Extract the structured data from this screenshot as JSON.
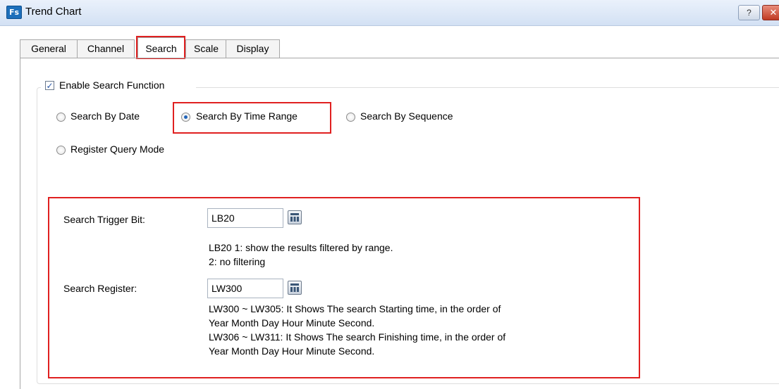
{
  "window": {
    "app_icon_text": "Fs",
    "title": "Trend Chart",
    "help_symbol": "?",
    "close_symbol": "✕"
  },
  "tabs": [
    "General",
    "Channel",
    "Search",
    "Scale",
    "Display"
  ],
  "active_tab": "Search",
  "search": {
    "enable_label": "Enable Search Function",
    "enable_checked": true,
    "modes": {
      "by_date": "Search By Date",
      "by_time_range": "Search By Time Range",
      "by_sequence": "Search By Sequence",
      "register_query": "Register Query Mode"
    },
    "selected_mode": "Search By Time Range",
    "trigger_bit": {
      "label": "Search Trigger Bit:",
      "value": "LB20",
      "desc_line1": "LB20 1: show the results filtered by range.",
      "desc_line2": "2: no filtering"
    },
    "register": {
      "label": "Search Register:",
      "value": "LW300",
      "desc_line1": "LW300 ~ LW305: It Shows The search Starting time, in the order of",
      "desc_line2": "Year Month Day Hour Minute Second.",
      "desc_line3": "LW306 ~ LW311: It Shows The search Finishing time, in the order of",
      "desc_line4": "Year Month Day Hour Minute Second."
    }
  },
  "colors": {
    "highlight": "#e02020",
    "radio_dot": "#1f63b8"
  }
}
